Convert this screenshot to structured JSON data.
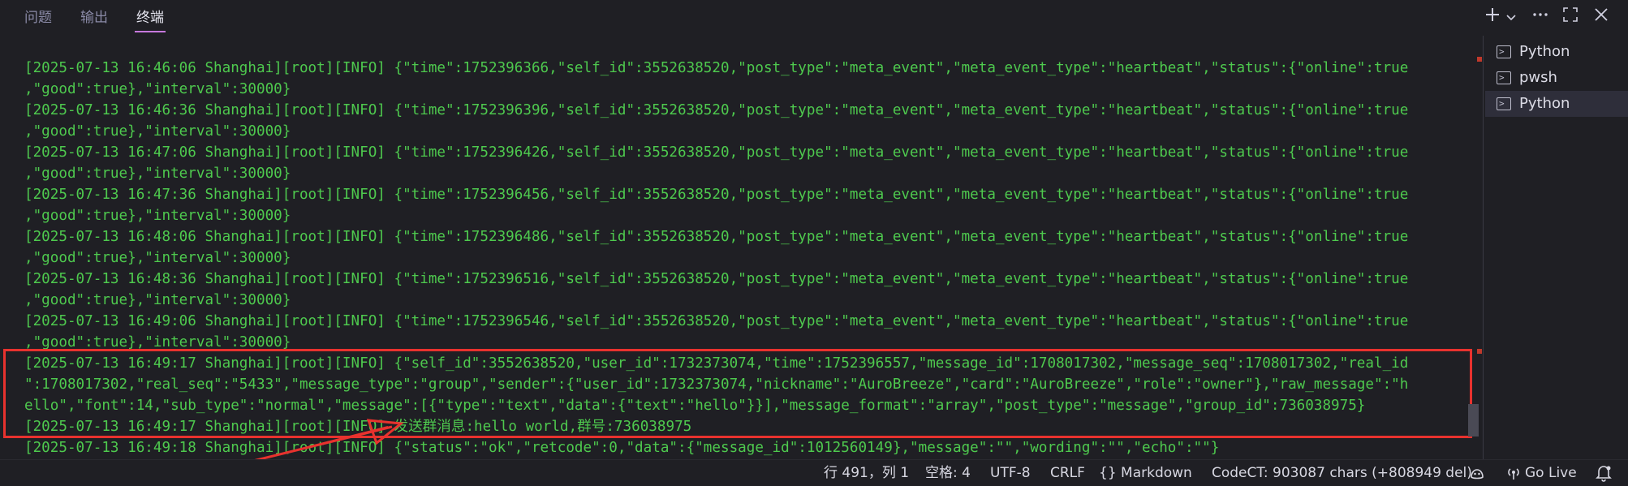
{
  "panel": {
    "tabs": [
      {
        "label": "问题"
      },
      {
        "label": "输出"
      },
      {
        "label": "终端"
      }
    ],
    "toolbar": {
      "new_terminal_icon": "plus-icon",
      "dropdown_icon": "chevron-down-icon",
      "more_icon": "more-icon",
      "maximize_icon": "maximize-icon",
      "close_icon": "close-icon"
    }
  },
  "terminal": {
    "lines": [
      "[2025-07-13 16:46:06 Shanghai][root][INFO] {\"time\":1752396366,\"self_id\":3552638520,\"post_type\":\"meta_event\",\"meta_event_type\":\"heartbeat\",\"status\":{\"online\":true",
      ",\"good\":true},\"interval\":30000}",
      "[2025-07-13 16:46:36 Shanghai][root][INFO] {\"time\":1752396396,\"self_id\":3552638520,\"post_type\":\"meta_event\",\"meta_event_type\":\"heartbeat\",\"status\":{\"online\":true",
      ",\"good\":true},\"interval\":30000}",
      "[2025-07-13 16:47:06 Shanghai][root][INFO] {\"time\":1752396426,\"self_id\":3552638520,\"post_type\":\"meta_event\",\"meta_event_type\":\"heartbeat\",\"status\":{\"online\":true",
      ",\"good\":true},\"interval\":30000}",
      "[2025-07-13 16:47:36 Shanghai][root][INFO] {\"time\":1752396456,\"self_id\":3552638520,\"post_type\":\"meta_event\",\"meta_event_type\":\"heartbeat\",\"status\":{\"online\":true",
      ",\"good\":true},\"interval\":30000}",
      "[2025-07-13 16:48:06 Shanghai][root][INFO] {\"time\":1752396486,\"self_id\":3552638520,\"post_type\":\"meta_event\",\"meta_event_type\":\"heartbeat\",\"status\":{\"online\":true",
      ",\"good\":true},\"interval\":30000}",
      "[2025-07-13 16:48:36 Shanghai][root][INFO] {\"time\":1752396516,\"self_id\":3552638520,\"post_type\":\"meta_event\",\"meta_event_type\":\"heartbeat\",\"status\":{\"online\":true",
      ",\"good\":true},\"interval\":30000}",
      "[2025-07-13 16:49:06 Shanghai][root][INFO] {\"time\":1752396546,\"self_id\":3552638520,\"post_type\":\"meta_event\",\"meta_event_type\":\"heartbeat\",\"status\":{\"online\":true",
      ",\"good\":true},\"interval\":30000}",
      "[2025-07-13 16:49:17 Shanghai][root][INFO] {\"self_id\":3552638520,\"user_id\":1732373074,\"time\":1752396557,\"message_id\":1708017302,\"message_seq\":1708017302,\"real_id",
      "\":1708017302,\"real_seq\":\"5433\",\"message_type\":\"group\",\"sender\":{\"user_id\":1732373074,\"nickname\":\"AuroBreeze\",\"card\":\"AuroBreeze\",\"role\":\"owner\"},\"raw_message\":\"h",
      "ello\",\"font\":14,\"sub_type\":\"normal\",\"message\":[{\"type\":\"text\",\"data\":{\"text\":\"hello\"}}],\"message_format\":\"array\",\"post_type\":\"message\",\"group_id\":736038975}",
      "[2025-07-13 16:49:17 Shanghai][root][INFO] 发送群消息:hello world,群号:736038975",
      "[2025-07-13 16:49:18 Shanghai][root][INFO] {\"status\":\"ok\",\"retcode\":0,\"data\":{\"message_id\":1012560149},\"message\":\"\",\"wording\":\"\",\"echo\":\"\"}"
    ],
    "highlight_color": "#e8322e",
    "text_color": "#4ec94e"
  },
  "terminal_list": [
    {
      "label": "Python",
      "icon": "terminal-icon"
    },
    {
      "label": "pwsh",
      "icon": "terminal-icon"
    },
    {
      "label": "Python",
      "icon": "terminal-icon"
    }
  ],
  "statusbar": {
    "cursor_position": "行 491，列 1",
    "indentation": "空格: 4",
    "encoding": "UTF-8",
    "eol": "CRLF",
    "language": "{} Markdown",
    "codect": "CodeCT: 903087 chars (+808949 del)",
    "go_live": "Go Live",
    "copilot_icon": "copilot-icon",
    "broadcast_icon": "broadcast-icon",
    "bell_icon": "bell-icon"
  }
}
